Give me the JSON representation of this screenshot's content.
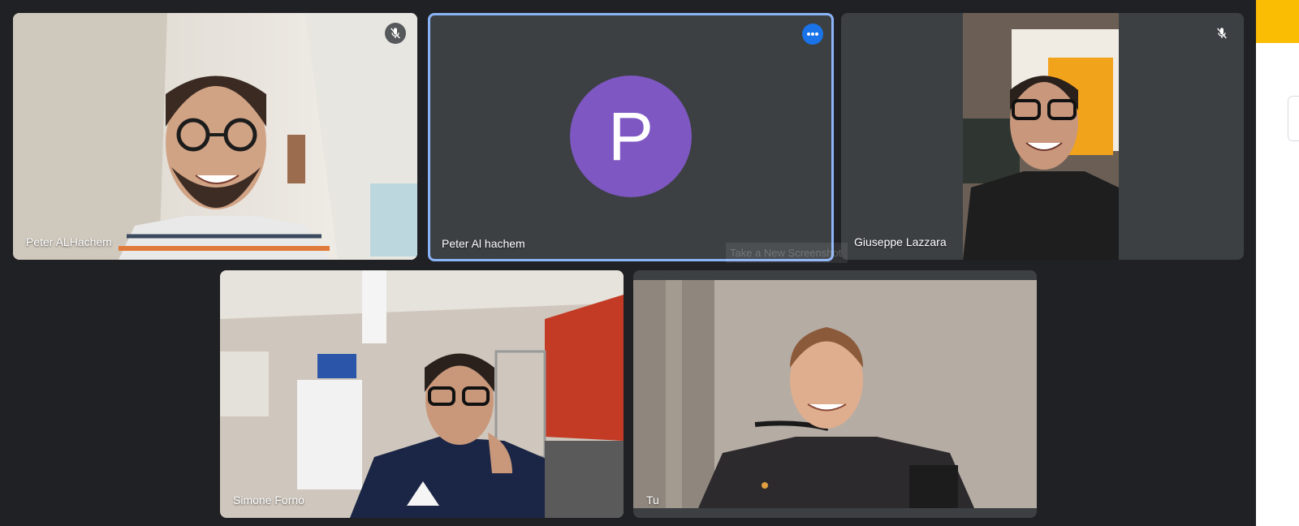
{
  "participants": [
    {
      "name": "Peter ALHachem",
      "muted": true
    },
    {
      "name": "Peter Al hachem",
      "avatar_letter": "P",
      "avatar_color": "#7e57c2",
      "active_speaker": true,
      "border_color": "#8ab4f8"
    },
    {
      "name": "Giuseppe Lazzara",
      "muted": true
    },
    {
      "name": "Simone Forno"
    },
    {
      "name": "Tu"
    }
  ],
  "tooltip": {
    "text": "Take a New Screenshot"
  },
  "colors": {
    "background": "#202124",
    "tile": "#3c4043",
    "accent": "#1a73e8",
    "side_accent": "#fbbc04"
  }
}
